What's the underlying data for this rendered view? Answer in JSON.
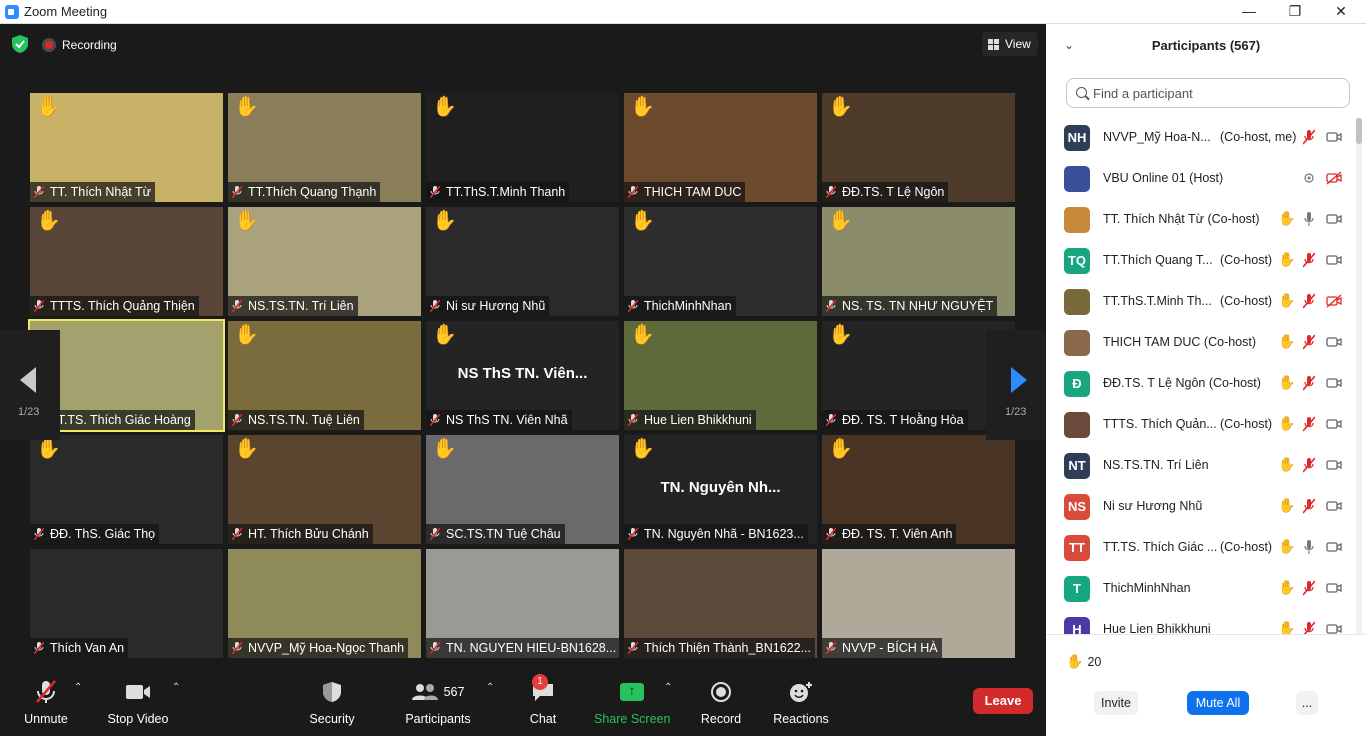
{
  "window": {
    "title": "Zoom Meeting",
    "minimize": "—",
    "maximize": "❐",
    "close": "✕"
  },
  "topbar": {
    "recording_label": "Recording",
    "view_label": "View"
  },
  "pager": {
    "left": "1/23",
    "right": "1/23"
  },
  "tiles": [
    {
      "name": "TT. Thích Nhật Từ",
      "hand": "✋",
      "big": "",
      "bg": "#c8b268",
      "active": false
    },
    {
      "name": "TT.Thích Quang Thạnh",
      "hand": "✋",
      "big": "",
      "bg": "#8a7d5a",
      "active": false
    },
    {
      "name": "TT.ThS.T.Minh Thanh",
      "hand": "✋",
      "big": "",
      "bg": "#1f1f1f",
      "active": false
    },
    {
      "name": "THICH TAM DUC",
      "hand": "✋",
      "big": "",
      "bg": "#6b4a2e",
      "active": false
    },
    {
      "name": "ĐĐ.TS. T Lệ Ngôn",
      "hand": "✋",
      "big": "",
      "bg": "#4e3a28",
      "active": false
    },
    {
      "name": "TTTS. Thích Quảng Thiện",
      "hand": "✋",
      "big": "",
      "bg": "#5a4638",
      "active": false
    },
    {
      "name": "NS.TS.TN. Trí Liên",
      "hand": "✋",
      "big": "",
      "bg": "#a9a27c",
      "active": false
    },
    {
      "name": "Ni sư Hương Nhũ",
      "hand": "✋",
      "big": "",
      "bg": "#2a2a2a",
      "active": false
    },
    {
      "name": "ThichMinhNhan",
      "hand": "✋",
      "big": "",
      "bg": "#2e2e2e",
      "active": false
    },
    {
      "name": "NS. TS. TN NHƯ NGUYỆT",
      "hand": "✋",
      "big": "",
      "bg": "#8a8c6a",
      "active": false
    },
    {
      "name": "TT.TS. Thích Giác Hoàng",
      "hand": "",
      "big": "",
      "bg": "#a3a26e",
      "active": true
    },
    {
      "name": "NS.TS.TN. Tuệ Liên",
      "hand": "✋",
      "big": "",
      "bg": "#7a6c3c",
      "active": false
    },
    {
      "name": "NS ThS TN. Viên Nhã",
      "hand": "✋",
      "big": "NS ThS TN. Viên...",
      "bg": "#242424",
      "active": false
    },
    {
      "name": "Hue Lien Bhikkhuni",
      "hand": "✋",
      "big": "",
      "bg": "#5e6a3a",
      "active": false
    },
    {
      "name": "ĐĐ. TS. T Hoằng Hòa",
      "hand": "✋",
      "big": "",
      "bg": "#242424",
      "active": false
    },
    {
      "name": "ĐĐ. ThS. Giác Thọ",
      "hand": "✋",
      "big": "",
      "bg": "#2a2a2a",
      "active": false
    },
    {
      "name": "HT. Thích Bửu Chánh",
      "hand": "✋",
      "big": "",
      "bg": "#5a4630",
      "active": false
    },
    {
      "name": "SC.TS.TN Tuệ Châu",
      "hand": "✋",
      "big": "",
      "bg": "#6a6a6a",
      "active": false
    },
    {
      "name": "TN. Nguyên Nhã - BN1623...",
      "hand": "✋",
      "big": "TN. Nguyên Nh...",
      "bg": "#242424",
      "active": false
    },
    {
      "name": "ĐĐ. TS. T. Viên Anh",
      "hand": "✋",
      "big": "",
      "bg": "#4a3424",
      "active": false
    },
    {
      "name": "Thích Van An",
      "hand": "",
      "big": "",
      "bg": "#2a2a2a",
      "active": false
    },
    {
      "name": "NVVP_Mỹ Hoa-Ngọc Thanh",
      "hand": "",
      "big": "",
      "bg": "#8f8a5a",
      "active": false
    },
    {
      "name": "TN. NGUYEN HIEU-BN1628...",
      "hand": "",
      "big": "",
      "bg": "#9a9a94",
      "active": false
    },
    {
      "name": "Thích Thiện Thành_BN1622...",
      "hand": "",
      "big": "",
      "bg": "#5c4a3a",
      "active": false
    },
    {
      "name": "NVVP - BÍCH HÀ",
      "hand": "",
      "big": "",
      "bg": "#b0a898",
      "active": false
    }
  ],
  "toolbar": {
    "unmute": "Unmute",
    "stop_video": "Stop Video",
    "security": "Security",
    "participants": "Participants",
    "participants_count": "567",
    "chat": "Chat",
    "chat_badge": "1",
    "share_screen": "Share Screen",
    "record": "Record",
    "reactions": "Reactions",
    "leave": "Leave"
  },
  "panel": {
    "title": "Participants (567)",
    "search_placeholder": "Find a participant",
    "participants": [
      {
        "initials": "NH",
        "color": "#2f3e57",
        "name": "NVVP_Mỹ Hoa-N...",
        "role": "(Co-host, me)",
        "hand": "",
        "mic": "muted",
        "video": "on"
      },
      {
        "initials": "",
        "color": "#3a4f9a",
        "name": "VBU Online 01 (Host)",
        "role": "",
        "hand": "",
        "mic": "none",
        "video": "off"
      },
      {
        "initials": "",
        "color": "#c88a3a",
        "name": "TT. Thích Nhật Từ (Co-host)",
        "role": "",
        "hand": "✋",
        "mic": "on",
        "video": "on"
      },
      {
        "initials": "TQ",
        "color": "#17a680",
        "name": "TT.Thích Quang T...",
        "role": "(Co-host)",
        "hand": "✋",
        "mic": "muted",
        "video": "on"
      },
      {
        "initials": "",
        "color": "#7a6a3a",
        "name": "TT.ThS.T.Minh Th...",
        "role": "(Co-host)",
        "hand": "✋",
        "mic": "muted",
        "video": "off"
      },
      {
        "initials": "",
        "color": "#8a6a4a",
        "name": "THICH TAM DUC (Co-host)",
        "role": "",
        "hand": "✋",
        "mic": "muted",
        "video": "on"
      },
      {
        "initials": "Đ",
        "color": "#17a680",
        "name": "ĐĐ.TS. T Lệ Ngôn (Co-host)",
        "role": "",
        "hand": "✋",
        "mic": "muted",
        "video": "on"
      },
      {
        "initials": "",
        "color": "#6a4a3a",
        "name": "TTTS. Thích Quản...",
        "role": "(Co-host)",
        "hand": "✋",
        "mic": "muted",
        "video": "on"
      },
      {
        "initials": "NT",
        "color": "#2f3e57",
        "name": "NS.TS.TN. Trí Liên",
        "role": "",
        "hand": "✋",
        "mic": "muted",
        "video": "on"
      },
      {
        "initials": "NS",
        "color": "#d94b3a",
        "name": "Ni sư Hương Nhũ",
        "role": "",
        "hand": "✋",
        "mic": "muted",
        "video": "on"
      },
      {
        "initials": "TT",
        "color": "#d94b3a",
        "name": "TT.TS. Thích Giác ...",
        "role": "(Co-host)",
        "hand": "✋",
        "mic": "on",
        "video": "on"
      },
      {
        "initials": "T",
        "color": "#17a680",
        "name": "ThichMinhNhan",
        "role": "",
        "hand": "✋",
        "mic": "muted",
        "video": "on"
      },
      {
        "initials": "H",
        "color": "#4a3aa6",
        "name": "Hue Lien Bhikkhuni",
        "role": "",
        "hand": "✋",
        "mic": "muted",
        "video": "on"
      }
    ],
    "raised_hands_icon": "✋",
    "raised_hands_count": "20",
    "invite": "Invite",
    "mute_all": "Mute All",
    "more": "..."
  }
}
